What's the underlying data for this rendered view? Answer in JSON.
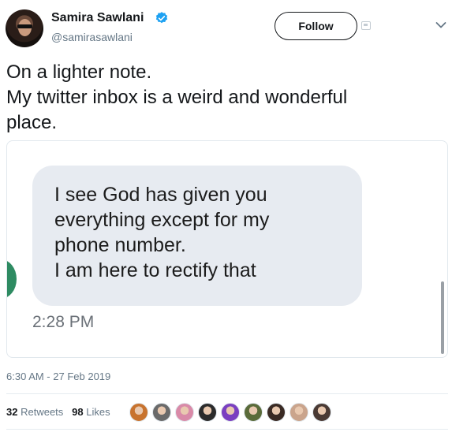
{
  "author": {
    "name": "Samira Sawlani",
    "handle": "@samirasawlani",
    "verified": true
  },
  "follow_label": "Follow",
  "tweet": {
    "lines": [
      "On a lighter note.",
      "My twitter inbox is a weird and wonderful",
      "place."
    ]
  },
  "media": {
    "message_lines": [
      "I see God has given you",
      "everything except for my",
      "phone number.",
      "I am here to rectify that"
    ],
    "message_time": "2:28 PM"
  },
  "timestamp": "6:30 AM - 27 Feb 2019",
  "stats": {
    "retweets_count": "32",
    "retweets_label": "Retweets",
    "likes_count": "98",
    "likes_label": "Likes"
  },
  "likers": [
    {
      "icon": "africa-map-avatar",
      "color": "#c8732e"
    },
    {
      "icon": "person-avatar",
      "color": "#6a6a6a"
    },
    {
      "icon": "pink-person-avatar",
      "color": "#d98aa8"
    },
    {
      "icon": "person-avatar",
      "color": "#2b2b2b"
    },
    {
      "icon": "purple-avatar",
      "color": "#7a3fc0"
    },
    {
      "icon": "person-avatar",
      "color": "#5a6b3a"
    },
    {
      "icon": "person-avatar",
      "color": "#3a2a24"
    },
    {
      "icon": "person-avatar",
      "color": "#caa48c"
    },
    {
      "icon": "person-avatar",
      "color": "#4a3a34"
    }
  ],
  "colors": {
    "verified_blue": "#1da1f2",
    "secondary_text": "#657786",
    "bubble_bg": "#e7ebf1"
  }
}
